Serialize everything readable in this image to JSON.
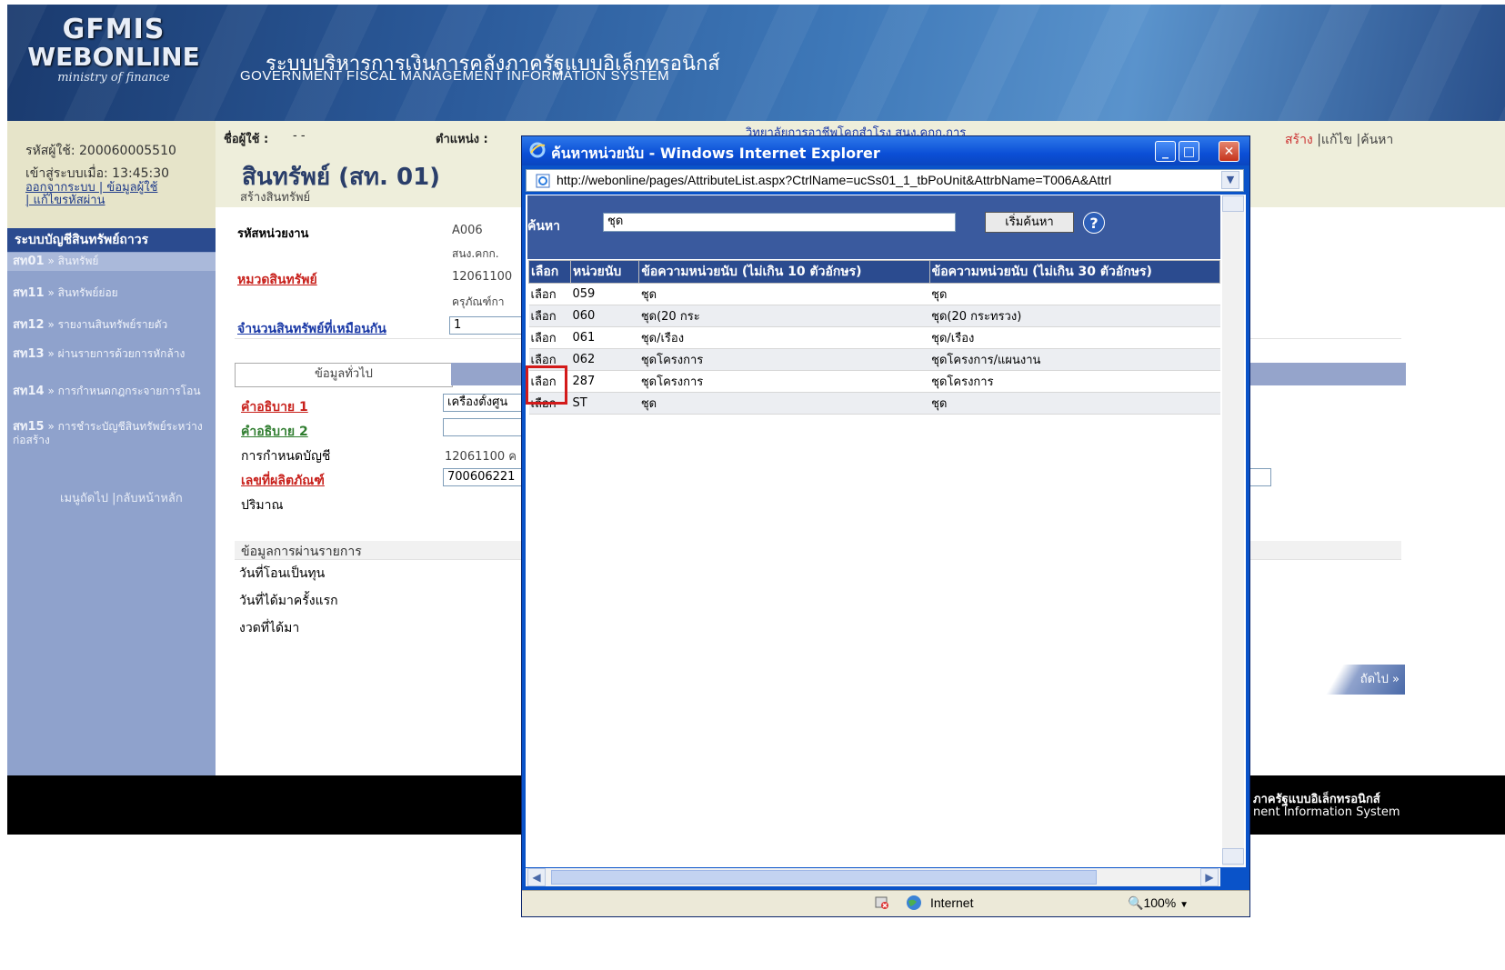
{
  "header": {
    "logo_line1": "GFMIS",
    "logo_line2": "WEBONLINE",
    "logo_line3": "ministry of finance",
    "title_th": "ระบบบริหารการเงินการคลังภาครัฐแบบอิเล็กทรอนิกส์",
    "title_en": "GOVERNMENT FISCAL MANAGEMENT INFORMATION SYSTEM"
  },
  "sidebar": {
    "user_code": "รหัสผู้ใช้: 200060005510",
    "login_time": "เข้าสู่ระบบเมื่อ: 13:45:30",
    "links_line1": "ออกจากระบบ | ข้อมูลผู้ใช้",
    "links_line2": "| แก้ไขรหัสผ่าน",
    "section_title": "ระบบบัญชีสินทรัพย์ถาวร",
    "items": [
      {
        "code": "สท01",
        "label": "» สินทรัพย์"
      },
      {
        "code": "สท11",
        "label": "» สินทรัพย์ย่อย"
      },
      {
        "code": "สท12",
        "label": "» รายงานสินทรัพย์รายตัว"
      },
      {
        "code": "สท13",
        "label": "» ผ่านรายการด้วยการหักล้าง"
      },
      {
        "code": "สท14",
        "label": "» การกำหนดกฎกระจายการโอน"
      },
      {
        "code": "สท15",
        "label": "» การชำระบัญชีสินทรัพย์ระหว่างก่อสร้าง"
      }
    ],
    "bottom_links": "เมนูถัดไป |กลับหน้าหลัก"
  },
  "topbar": {
    "user_label": "ชื่อผู้ใช้ :",
    "user_value": "- -",
    "position_label": "ตำแหน่ง :",
    "org_value": "วิทยาลัยการอาชีพโคกสำโรง สนง.คกก.การ",
    "link_create": "สร้าง",
    "link_edit": "|แก้ไข",
    "link_search": "|ค้นหา"
  },
  "page": {
    "title": "สินทรัพย์ (สท. 01)",
    "subtitle": "สร้างสินทรัพย์"
  },
  "form": {
    "unit_code_label": "รหัสหน่วยงาน",
    "unit_code_value": "A006",
    "unit_name_value": "สนง.คกก.",
    "asset_cat_label": "หมวดสินทรัพย์",
    "asset_cat_value": "12061100",
    "asset_cat_desc": "ครุภัณฑ์กา",
    "qty_same_label": "จำนวนสินทรัพย์ที่เหมือนกัน",
    "qty_same_value": "1",
    "tab_general": "ข้อมูลทั่วไป",
    "desc1_label": "คำอธิบาย 1",
    "desc1_value": "เครื่องตั้งศูน",
    "desc2_label": "คำอธิบาย 2",
    "acct_label": "การกำหนดบัญชี",
    "acct_value": "12061100 ค",
    "serial_label": "เลขที่ผลิตภัณฑ์",
    "serial_value": "700606221",
    "quantity_label": "ปริมาณ",
    "posting_section": "ข้อมูลการผ่านรายการ",
    "capitalize_label": "วันที่โอนเป็นทุน",
    "acquire_label": "วันที่ได้มาครั้งแรก",
    "period_label": "งวดที่ได้มา",
    "next_button": "ถัดไป »"
  },
  "footer": {
    "th": "ภาครัฐแบบอิเล็กทรอนิกส์",
    "en": "nent Information System"
  },
  "popup": {
    "title": "ค้นหาหน่วยนับ - Windows Internet Explorer",
    "url": "http://webonline/pages/AttributeList.aspx?CtrlName=ucSs01_1_tbPoUnit&AttrbName=T006A&Attrl",
    "search_label": "ค้นหา",
    "search_value": "ชุด",
    "search_button": "เริ่มค้นหา",
    "columns": [
      "เลือก",
      "หน่วยนับ",
      "ข้อความหน่วยนับ (ไม่เกิน 10 ตัวอักษร)",
      "ข้อความหน่วยนับ (ไม่เกิน 30 ตัวอักษร)"
    ],
    "rows": [
      {
        "select": "เลือก",
        "unit": "059",
        "short": "ชุด",
        "long": "ชุด"
      },
      {
        "select": "เลือก",
        "unit": "060",
        "short": "ชุด(20 กระ",
        "long": "ชุด(20 กระทรวง)"
      },
      {
        "select": "เลือก",
        "unit": "061",
        "short": "ชุด/เรือง",
        "long": "ชุด/เรือง"
      },
      {
        "select": "เลือก",
        "unit": "062",
        "short": "ชุดโครงการ",
        "long": "ชุดโครงการ/แผนงาน"
      },
      {
        "select": "เลือก",
        "unit": "287",
        "short": "ชุดโครงการ",
        "long": "ชุดโครงการ"
      },
      {
        "select": "เลือก",
        "unit": "ST",
        "short": "ชุด",
        "long": "ชุด"
      }
    ],
    "status_zone": "Internet",
    "zoom": "100%"
  }
}
